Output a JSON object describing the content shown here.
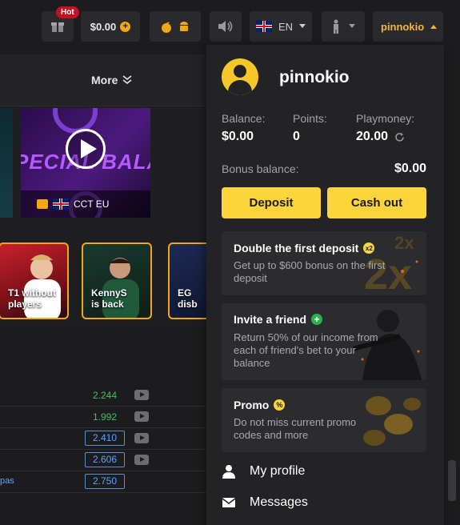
{
  "topbar": {
    "hot_badge": "Hot",
    "balance": "$0.00",
    "plus_symbol": "+",
    "language": "EN",
    "username": "pinnokio"
  },
  "left": {
    "more_label": "More",
    "stream_caption": "CCT EU",
    "stream_banner_text": "PECIAL BALANC",
    "stories": [
      {
        "line1": "T1 without",
        "line2": "players"
      },
      {
        "line1": "KennyS",
        "line2": "is back"
      },
      {
        "line1": "EG",
        "line2": "disb"
      }
    ],
    "odds": [
      {
        "value": "2.244",
        "style": "green",
        "video": true
      },
      {
        "value": "1.992",
        "style": "green",
        "video": true
      },
      {
        "value": "2.410",
        "style": "boxed",
        "video": true
      },
      {
        "value": "2.606",
        "style": "boxed",
        "video": true
      },
      {
        "value": "2.750",
        "style": "boxed",
        "video": false,
        "link": "pas"
      }
    ]
  },
  "panel": {
    "username": "pinnokio",
    "balance_label": "Balance:",
    "balance_value": "$0.00",
    "points_label": "Points:",
    "points_value": "0",
    "playmoney_label": "Playmoney:",
    "playmoney_value": "20.00",
    "bonus_label": "Bonus balance:",
    "bonus_value": "$0.00",
    "deposit_label": "Deposit",
    "cashout_label": "Cash out",
    "promos": [
      {
        "title": "Double the first deposit",
        "badge": "x2",
        "desc": "Get up to $600 bonus on the first deposit"
      },
      {
        "title": "Invite a friend",
        "badge": "+",
        "desc": "Return 50% of our income from each of friend's bet to your balance"
      },
      {
        "title": "Promo",
        "badge": "%",
        "desc": "Do not miss current promo codes and more"
      }
    ],
    "menu": [
      {
        "label": "My profile",
        "icon": "person-icon"
      },
      {
        "label": "Messages",
        "icon": "envelope-icon"
      }
    ]
  },
  "colors": {
    "accent_yellow": "#fcd53a",
    "username_orange": "#f5b53b",
    "odd_green": "#39c463",
    "odd_blue": "#5aa3ff",
    "hot_red": "#c1121f"
  }
}
